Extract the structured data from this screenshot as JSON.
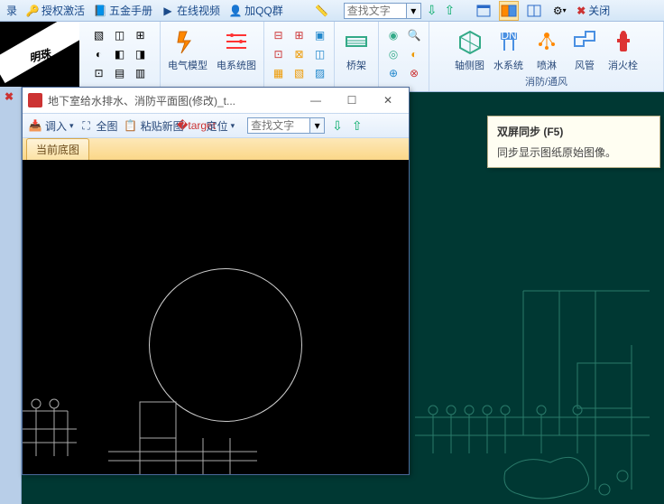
{
  "topbar": {
    "items": [
      {
        "label": "录",
        "icon": "list"
      },
      {
        "label": "授权激活",
        "icon": "key"
      },
      {
        "label": "五金手册",
        "icon": "book"
      },
      {
        "label": "在线视频",
        "icon": "play"
      },
      {
        "label": "加QQ群",
        "icon": "qq"
      }
    ],
    "search_placeholder": "查找文字",
    "close_label": "关闭"
  },
  "ribbon": {
    "groups": [
      {
        "label": "",
        "buttons": [
          {
            "t": "电气模型"
          },
          {
            "t": "电系统图"
          }
        ]
      },
      {
        "label": "",
        "buttons": [
          {
            "t": "桥架"
          }
        ]
      },
      {
        "label": "",
        "buttons": [
          {
            "t": "轴侧图"
          },
          {
            "t": "水系统"
          },
          {
            "t": "喷淋"
          },
          {
            "t": "风管"
          },
          {
            "t": "消火栓"
          }
        ]
      }
    ],
    "group_label_right": "消防/通风"
  },
  "childwin": {
    "title": "地下室给水排水、消防平面图(修改)_t...",
    "toolbar": [
      {
        "label": "调入",
        "icon": "import"
      },
      {
        "label": "全图",
        "icon": "fit"
      },
      {
        "label": "粘贴新图",
        "icon": "paste"
      },
      {
        "label": "定位",
        "icon": "locate"
      }
    ],
    "search_placeholder": "查找文字",
    "tab": "当前底图"
  },
  "tooltip": {
    "title": "双屏同步 (F5)",
    "body": "同步显示图纸原始图像。"
  },
  "colors": {
    "accent": "#2a6ac8",
    "ribbon_bg": "#e6f0fb",
    "active": "#fde5a7"
  }
}
